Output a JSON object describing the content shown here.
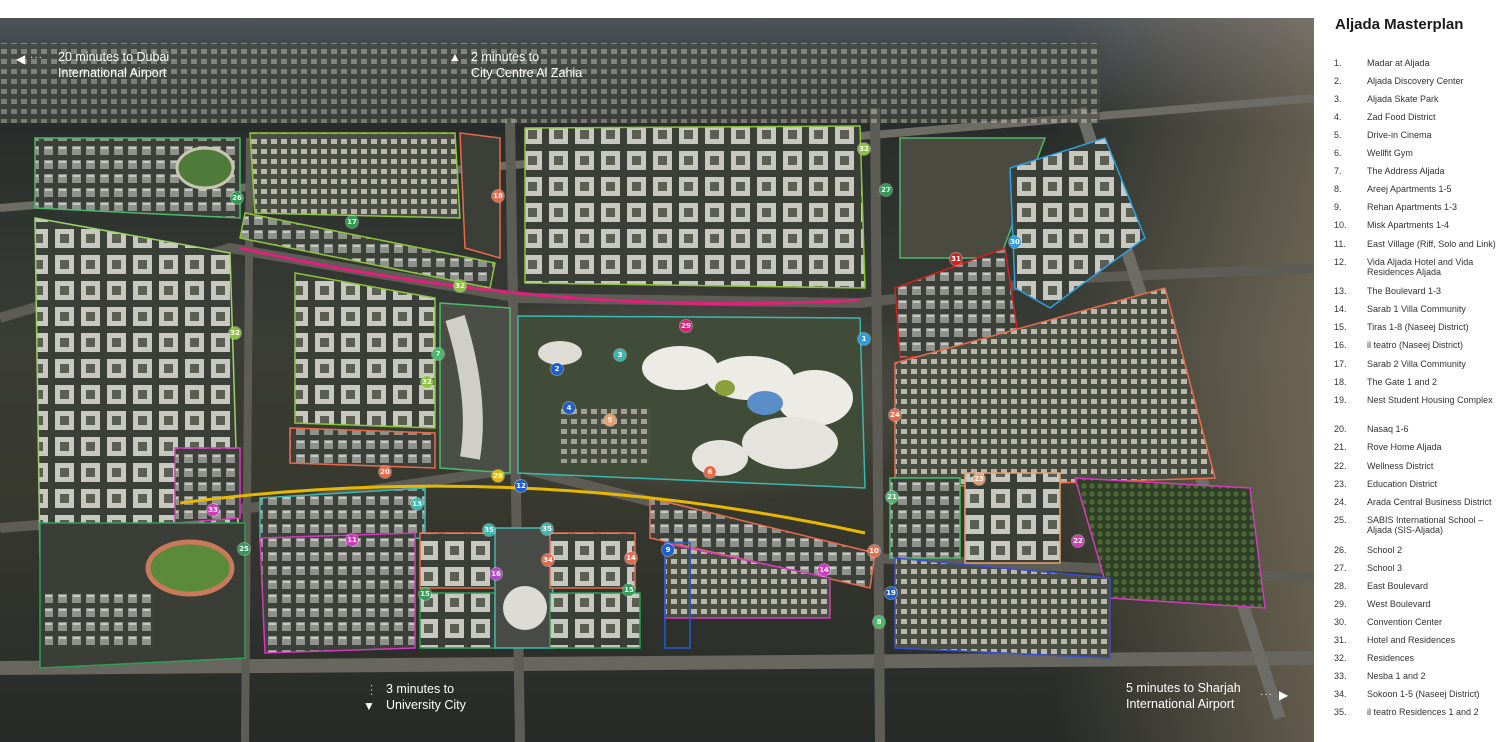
{
  "legend": {
    "title": "Aljada Masterplan",
    "items": [
      {
        "num": "1.",
        "label": "Madar at Aljada"
      },
      {
        "num": "2.",
        "label": "Aljada Discovery Center"
      },
      {
        "num": "3.",
        "label": "Aljada Skate Park"
      },
      {
        "num": "4.",
        "label": "Zad Food District"
      },
      {
        "num": "5.",
        "label": "Drive-in Cinema"
      },
      {
        "num": "6.",
        "label": "Wellfit Gym"
      },
      {
        "num": "7.",
        "label": "The Address Aljada"
      },
      {
        "num": "8.",
        "label": "Areej Apartments 1-5"
      },
      {
        "num": "9.",
        "label": "Rehan Apartments 1-3"
      },
      {
        "num": "10.",
        "label": "Misk Apartments 1-4"
      },
      {
        "num": "11.",
        "label": "East Village (Riff, Solo and Link)"
      },
      {
        "num": "12.",
        "label": "Vida Aljada Hotel and Vida Residences Aljada"
      },
      {
        "num": "13.",
        "label": "The Boulevard 1-3"
      },
      {
        "num": "14.",
        "label": "Sarab 1 Villa Community"
      },
      {
        "num": "15.",
        "label": "Tiras 1-8 (Naseej District)"
      },
      {
        "num": "16.",
        "label": "il teatro (Naseej District)"
      },
      {
        "num": "17.",
        "label": "Sarab 2 Villa Community"
      },
      {
        "num": "18.",
        "label": "The Gate 1 and 2"
      },
      {
        "num": "19.",
        "label": "Nest Student Housing Complex"
      },
      {
        "num": "20.",
        "label": "Nasaq 1-6"
      },
      {
        "num": "21.",
        "label": "Rove Home Aljada"
      },
      {
        "num": "22.",
        "label": "Wellness District"
      },
      {
        "num": "23.",
        "label": "Education District"
      },
      {
        "num": "24.",
        "label": "Arada Central Business District"
      },
      {
        "num": "25.",
        "label": "SABIS International School – Aljada (SIS-Aljada)"
      },
      {
        "num": "26.",
        "label": "School 2"
      },
      {
        "num": "27.",
        "label": "School 3"
      },
      {
        "num": "28.",
        "label": "East Boulevard"
      },
      {
        "num": "29.",
        "label": "West Boulevard"
      },
      {
        "num": "30.",
        "label": "Convention Center"
      },
      {
        "num": "31.",
        "label": "Hotel and Residences"
      },
      {
        "num": "32.",
        "label": "Residences"
      },
      {
        "num": "33.",
        "label": "Nesba 1 and 2"
      },
      {
        "num": "34.",
        "label": "Sokoon 1-5 (Naseej District)"
      },
      {
        "num": "35.",
        "label": "il teatro Residences 1 and 2"
      }
    ]
  },
  "callouts": {
    "dubai": {
      "line1": "20 minutes to Dubai",
      "line2": "International Airport",
      "arrow": "◀"
    },
    "city_centre": {
      "line1": "2 minutes to",
      "line2": "City Centre Al Zahia",
      "arrow": "▲"
    },
    "university": {
      "line1": "3 minutes to",
      "line2": "University City",
      "arrow": "▼"
    },
    "sharjah": {
      "line1": "5 minutes to Sharjah",
      "line2": "International Airport",
      "arrow": "▶"
    }
  },
  "markers": [
    {
      "label": "1",
      "color": "#2aa0e0"
    },
    {
      "label": "2",
      "color": "#1e5fd0"
    },
    {
      "label": "3",
      "color": "#3bb8b0"
    },
    {
      "label": "4",
      "color": "#1e5fd0"
    },
    {
      "label": "5",
      "color": "#e8a070"
    },
    {
      "label": "6",
      "color": "#e86a4a"
    },
    {
      "label": "7",
      "color": "#4db86a"
    },
    {
      "label": "8",
      "color": "#4db86a"
    },
    {
      "label": "9",
      "color": "#1e5fd0"
    },
    {
      "label": "10",
      "color": "#e86a4a"
    },
    {
      "label": "11",
      "color": "#d43ac0"
    },
    {
      "label": "12",
      "color": "#1e5fd0"
    },
    {
      "label": "13",
      "color": "#3bb8b0"
    },
    {
      "label": "14",
      "color": "#d43ac0"
    },
    {
      "label": "14",
      "color": "#e86a4a"
    },
    {
      "label": "15",
      "color": "#2e9e55"
    },
    {
      "label": "15",
      "color": "#2e9e55"
    },
    {
      "label": "16",
      "color": "#b04ac8"
    },
    {
      "label": "17",
      "color": "#2e9e55"
    },
    {
      "label": "18",
      "color": "#e86a4a"
    },
    {
      "label": "19",
      "color": "#1e5fd0"
    },
    {
      "label": "20",
      "color": "#e86a4a"
    },
    {
      "label": "21",
      "color": "#4db86a"
    },
    {
      "label": "22",
      "color": "#d43ac0"
    },
    {
      "label": "23",
      "color": "#e8a070"
    },
    {
      "label": "24",
      "color": "#e86a4a"
    },
    {
      "label": "25",
      "color": "#2e9e55"
    },
    {
      "label": "26",
      "color": "#2e9e55"
    },
    {
      "label": "27",
      "color": "#2e9e55"
    },
    {
      "label": "28",
      "color": "#e8b800"
    },
    {
      "label": "29",
      "color": "#e0207a"
    },
    {
      "label": "30",
      "color": "#2aa0e0"
    },
    {
      "label": "31",
      "color": "#d42020"
    },
    {
      "label": "32",
      "color": "#8cc43a"
    },
    {
      "label": "32",
      "color": "#8cc43a"
    },
    {
      "label": "32",
      "color": "#8cc43a"
    },
    {
      "label": "32",
      "color": "#8cc43a"
    },
    {
      "label": "33",
      "color": "#d43ac0"
    },
    {
      "label": "34",
      "color": "#e86a4a"
    },
    {
      "label": "35",
      "color": "#3bb8b0"
    },
    {
      "label": "35",
      "color": "#3bb8b0"
    }
  ]
}
